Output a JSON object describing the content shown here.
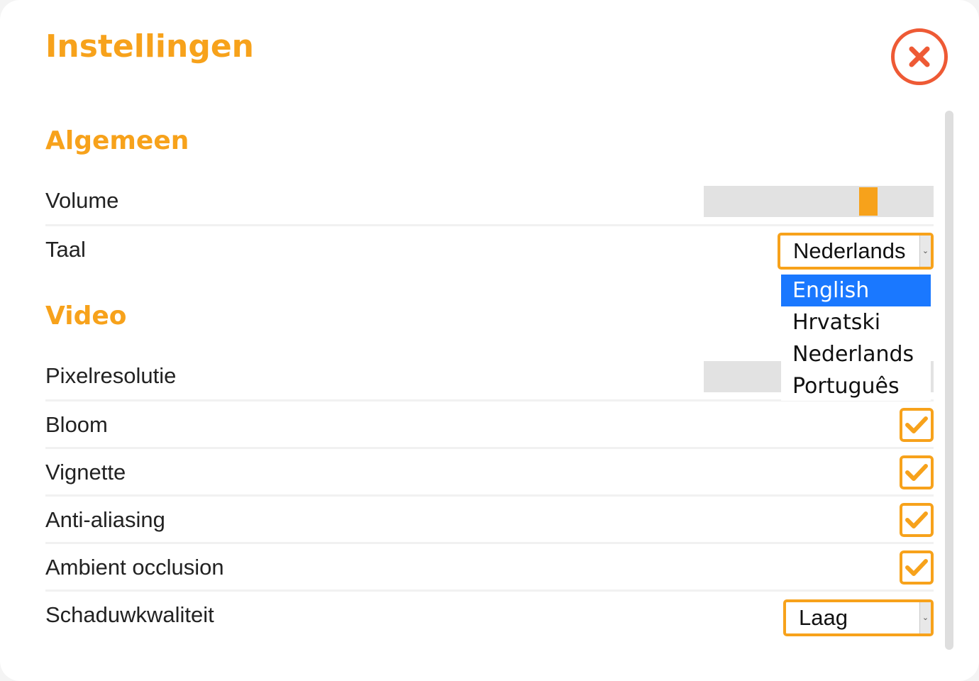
{
  "dialog": {
    "title": "Instellingen",
    "close_icon": "close-x-icon"
  },
  "sections": {
    "general": "Algemeen",
    "video": "Video"
  },
  "settings": {
    "volume": {
      "label": "Volume",
      "value_fraction": 0.8
    },
    "language": {
      "label": "Taal",
      "value": "Nederlands",
      "options": [
        "English",
        "Hrvatski",
        "Nederlands",
        "Português"
      ],
      "highlighted": "English"
    },
    "pixel_resolution": {
      "label": "Pixelresolutie"
    },
    "bloom": {
      "label": "Bloom",
      "checked": true
    },
    "vignette": {
      "label": "Vignette",
      "checked": true
    },
    "anti_aliasing": {
      "label": "Anti-aliasing",
      "checked": true
    },
    "ambient_occlusion": {
      "label": "Ambient occlusion",
      "checked": true
    },
    "shadow_quality": {
      "label": "Schaduwkwaliteit",
      "value": "Laag"
    }
  },
  "colors": {
    "accent": "#f7a21b",
    "close": "#ee5a35",
    "highlight": "#1a78ff"
  }
}
